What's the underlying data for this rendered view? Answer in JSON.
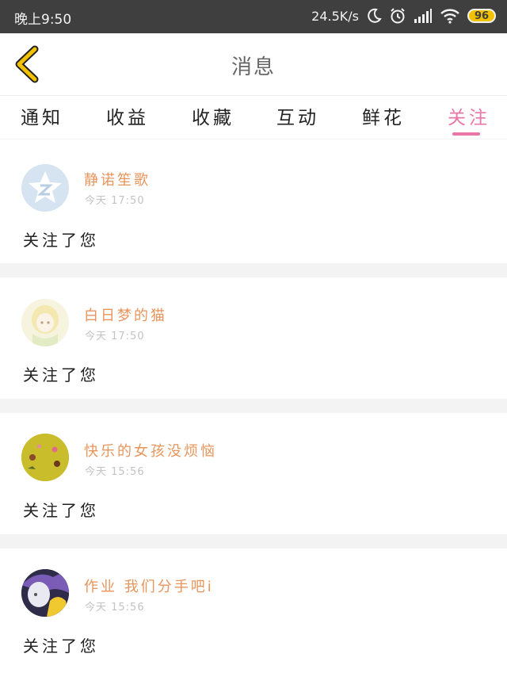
{
  "status_bar": {
    "time": "晚上9:50",
    "net_speed": "24.5K/s",
    "battery": "96",
    "icons": [
      "moon-icon",
      "alarm-icon",
      "signal-icon",
      "wifi-icon",
      "battery-icon"
    ]
  },
  "header": {
    "title": "消息",
    "back_icon": "chevron-left-icon",
    "accent_color": "#f2c100"
  },
  "tabs": [
    {
      "label": "通知"
    },
    {
      "label": "收益"
    },
    {
      "label": "收藏"
    },
    {
      "label": "互动"
    },
    {
      "label": "鲜花"
    },
    {
      "label": "关注",
      "active": true
    }
  ],
  "notifications": [
    {
      "name": "静诺笙歌",
      "time": "今天 17:50",
      "message": "关注了您"
    },
    {
      "name": "白日梦的猫",
      "time": "今天 17:50",
      "message": "关注了您"
    },
    {
      "name": "快乐的女孩没烦恼",
      "time": "今天 15:56",
      "message": "关注了您"
    },
    {
      "name": "作业 我们分手吧i",
      "time": "今天 15:56",
      "message": "关注了您"
    }
  ],
  "colors": {
    "active_tab": "#e877a7",
    "username": "#e8955c",
    "status_bar": "#3f3f3f"
  }
}
